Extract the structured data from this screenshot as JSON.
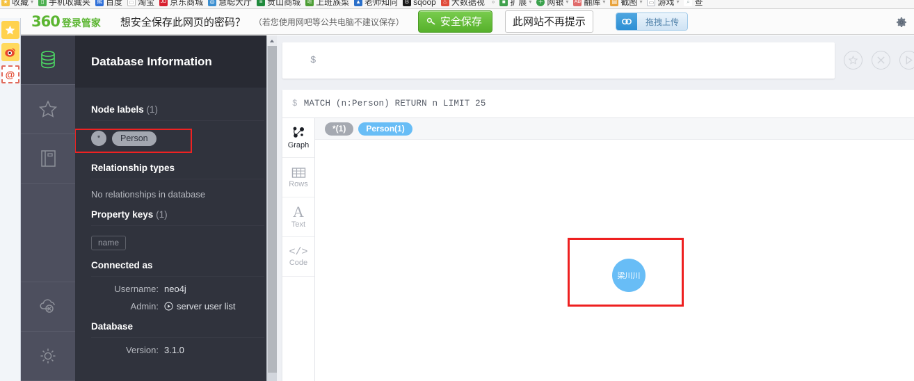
{
  "browser": {
    "bookmarks": [
      {
        "label": "收藏",
        "icon": "folder-star-icon",
        "color": "#f5c242",
        "glyph": "★",
        "dropdown": true
      },
      {
        "label": "手机收藏夹",
        "icon": "phone-bookmark-icon",
        "color": "#4caf50",
        "glyph": "▯",
        "dropdown": false
      },
      {
        "label": "百度",
        "icon": "baidu-icon",
        "color": "#2e6fd9",
        "glyph": "熊",
        "dropdown": false
      },
      {
        "label": "淘宝",
        "icon": "taobao-icon",
        "color": "#ffffff",
        "glyph": "□",
        "dropdown": false
      },
      {
        "label": "京东商城",
        "icon": "jd-icon",
        "color": "#d8202f",
        "glyph": "JD",
        "dropdown": false
      },
      {
        "label": "慧聪大厅",
        "icon": "hc-icon",
        "color": "#3c8fd0",
        "glyph": "◎",
        "dropdown": false
      },
      {
        "label": "贡山商城",
        "icon": "gs-icon",
        "color": "#1f8a3c",
        "glyph": "≡",
        "dropdown": false
      },
      {
        "label": "上班族菜",
        "icon": "sbz-icon",
        "color": "#4d9e35",
        "glyph": "班",
        "dropdown": false
      },
      {
        "label": "老师知向",
        "icon": "lsz-icon",
        "color": "#2a6fc9",
        "glyph": "▲",
        "dropdown": false
      },
      {
        "label": "sqoop",
        "icon": "sqoop-icon",
        "color": "#1b1b1b",
        "glyph": "B",
        "dropdown": false
      },
      {
        "label": "大数据视",
        "icon": "bigdata-icon",
        "color": "#e04b3a",
        "glyph": "♨",
        "dropdown": false
      },
      {
        "label": "扩展",
        "icon": "extensions-icon",
        "color": "#3fa14c",
        "glyph": "■",
        "dropdown": true
      },
      {
        "label": "网银",
        "icon": "bank-icon",
        "color": "#3aa14c",
        "glyph": "＋",
        "dropdown": true
      },
      {
        "label": "翻库",
        "icon": "translate-icon",
        "color": "#e06a6a",
        "glyph": "AB",
        "dropdown": true
      },
      {
        "label": "截图",
        "icon": "screenshot-icon",
        "color": "#e8a33d",
        "glyph": "▤",
        "dropdown": true
      },
      {
        "label": "游戏",
        "icon": "games-icon",
        "color": "#b8bcc4",
        "glyph": "▭",
        "dropdown": true
      },
      {
        "label": "查",
        "icon": "search-bookmark-icon",
        "color": "#b8bcc4",
        "glyph": "🔍",
        "dropdown": false
      }
    ],
    "overflow_label": "»",
    "edge_buttons": [
      {
        "name": "favorites-star-button",
        "glyph": "★"
      },
      {
        "name": "weibo-button",
        "glyph": "◉"
      },
      {
        "name": "mail-button",
        "glyph": "@"
      }
    ]
  },
  "password_bar": {
    "brand_number": "360",
    "brand_text": "登录管家",
    "question": "想安全保存此网页的密码？",
    "note": "（若您使用网吧等公共电脑不建议保存）",
    "save_label": "安全保存",
    "save_icon": "key-icon",
    "never_label": "此网站不再提示",
    "gear_icon": "gear-icon",
    "accent_green": "#5bb531"
  },
  "cloud_widget": {
    "icon": "cloud-upload-icon",
    "label": "拖拽上传"
  },
  "neo4j": {
    "icon_rail": [
      {
        "name": "sidebar-item-database",
        "icon": "database-icon",
        "active": true
      },
      {
        "name": "sidebar-item-favorites",
        "icon": "star-icon",
        "active": false
      },
      {
        "name": "sidebar-item-documents",
        "icon": "book-icon",
        "active": false
      },
      {
        "name": "sidebar-item-cloud",
        "icon": "cloud-off-icon",
        "active": false
      },
      {
        "name": "sidebar-item-settings",
        "icon": "gear-icon",
        "active": false
      }
    ],
    "drawer": {
      "title": "Database Information",
      "node_labels": {
        "heading": "Node labels",
        "count": "(1)",
        "all_chip": "*",
        "labels": [
          "Person"
        ]
      },
      "relationship_types": {
        "heading": "Relationship types",
        "empty_text": "No relationships in database"
      },
      "property_keys": {
        "heading": "Property keys",
        "count": "(1)",
        "keys": [
          "name"
        ]
      },
      "connected_as": {
        "heading": "Connected as",
        "username_label": "Username:",
        "username_value": "neo4j",
        "admin_label": "Admin:",
        "admin_value": "server user list",
        "admin_icon": "play-circle-icon"
      },
      "database": {
        "heading": "Database",
        "version_label": "Version:",
        "version_value": "3.1.0"
      }
    },
    "editor": {
      "prompt": "$",
      "value": "",
      "buttons": [
        {
          "name": "favorite-query-button",
          "icon": "star-circle-icon"
        },
        {
          "name": "clear-editor-button",
          "icon": "close-circle-icon"
        },
        {
          "name": "run-query-button",
          "icon": "play-circle-icon"
        }
      ]
    },
    "frame": {
      "prompt": "$",
      "query": "MATCH (n:Person) RETURN n LIMIT 25",
      "head_buttons": [
        {
          "name": "download-button",
          "icon": "download-icon"
        },
        {
          "name": "pin-button",
          "icon": "pin-icon"
        },
        {
          "name": "fullscreen-button",
          "icon": "expand-icon"
        },
        {
          "name": "collapse-button",
          "icon": "chevron-up-icon"
        },
        {
          "name": "close-frame-button",
          "icon": "close-icon"
        }
      ],
      "views": [
        {
          "name": "view-graph",
          "label": "Graph",
          "icon": "graph-icon",
          "active": true
        },
        {
          "name": "view-rows",
          "label": "Rows",
          "icon": "table-icon",
          "active": false
        },
        {
          "name": "view-text",
          "label": "Text",
          "icon": "text-icon",
          "active": false
        },
        {
          "name": "view-code",
          "label": "Code",
          "icon": "code-icon",
          "active": false
        }
      ],
      "result_chips": [
        {
          "label": "*(1)",
          "style": "grey"
        },
        {
          "label": "Person(1)",
          "style": "blue"
        }
      ],
      "graph": {
        "nodes": [
          {
            "label": "梁川川",
            "color": "#68bdf6"
          }
        ]
      }
    }
  }
}
